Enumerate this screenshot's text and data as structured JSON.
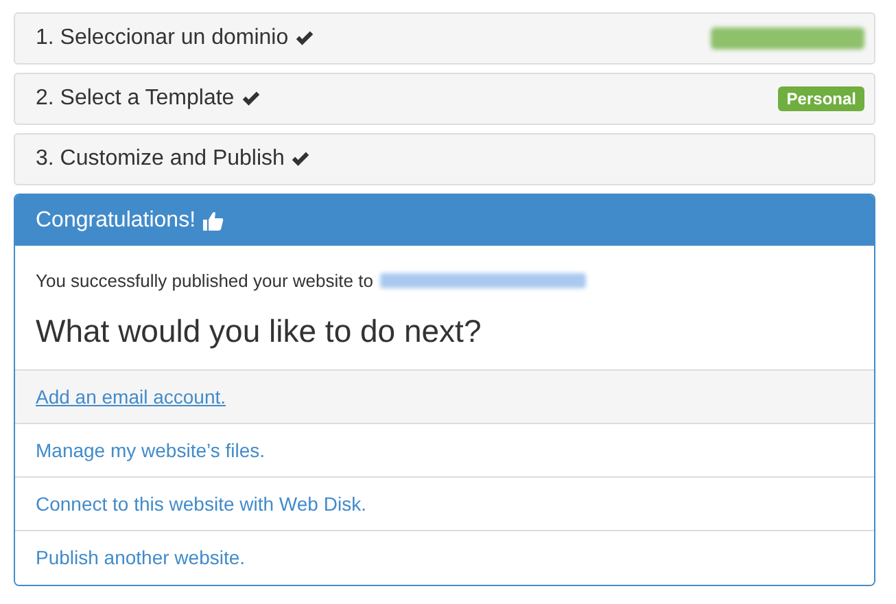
{
  "steps": [
    {
      "label": "1. Seleccionar un dominio",
      "done": true,
      "badge": {
        "kind": "blurred"
      }
    },
    {
      "label": "2. Select a Template",
      "done": true,
      "badge": {
        "kind": "label",
        "text": "Personal"
      }
    },
    {
      "label": "3. Customize and Publish",
      "done": true
    }
  ],
  "panel": {
    "title": "Congratulations!",
    "message": "You successfully published your website to",
    "link_blurred": true,
    "heading": "What would you like to do next?",
    "actions": [
      {
        "label": "Add an email account.",
        "hovered": true
      },
      {
        "label": "Manage my website’s files.",
        "hovered": false
      },
      {
        "label": "Connect to this website with Web Disk.",
        "hovered": false
      },
      {
        "label": "Publish another website.",
        "hovered": false
      }
    ]
  }
}
